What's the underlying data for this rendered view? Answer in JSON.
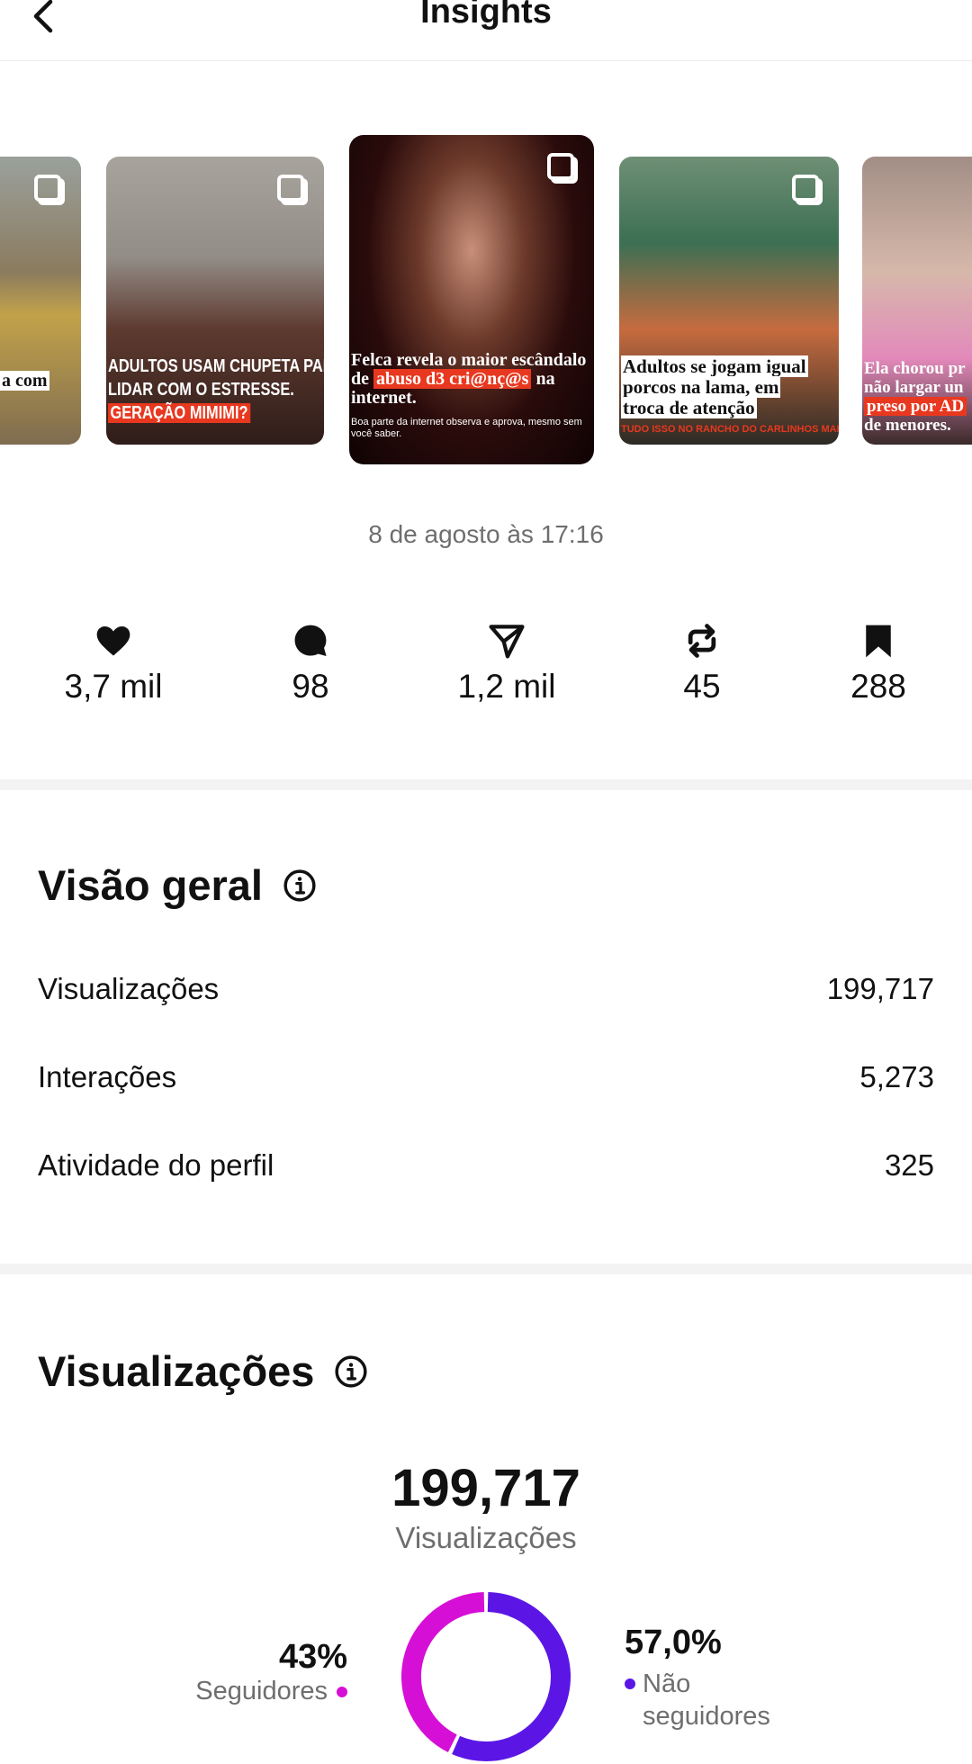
{
  "header": {
    "title": "Insights"
  },
  "carousel": {
    "items": [
      {
        "caption_lines": [
          "a com"
        ]
      },
      {
        "caption_lines": [
          "ADULTOS USAM CHUPETA PARA",
          "LIDAR COM O ESTRESSE."
        ],
        "highlight": "GERAÇÃO MIMIMI?"
      },
      {
        "caption_pre": "Felca revela o maior escândalo de ",
        "highlight": "abuso d3 cri@nç@s",
        "caption_post": " na internet.",
        "subtext": "Boa parte da internet observa e aprova, mesmo sem você saber."
      },
      {
        "caption_lines": [
          "Adultos se jogam igual",
          "porcos na lama, em",
          "troca de atenção"
        ],
        "footer": "TUDO ISSO NO RANCHO DO CARLINHOS MAIA"
      },
      {
        "caption_lines": [
          "Ela chorou pr",
          "não largar un"
        ],
        "highlight": "preso por AD",
        "caption_post": "de menores."
      }
    ]
  },
  "post": {
    "date": "8 de agosto às 17:16"
  },
  "stats": [
    {
      "icon": "heart-icon",
      "value": "3,7 mil"
    },
    {
      "icon": "comment-icon",
      "value": "98"
    },
    {
      "icon": "share-icon",
      "value": "1,2 mil"
    },
    {
      "icon": "repost-icon",
      "value": "45"
    },
    {
      "icon": "bookmark-icon",
      "value": "288"
    }
  ],
  "overview": {
    "title": "Visão geral",
    "rows": [
      {
        "label": "Visualizações",
        "value": "199,717"
      },
      {
        "label": "Interações",
        "value": "5,273"
      },
      {
        "label": "Atividade do perfil",
        "value": "325"
      }
    ]
  },
  "views": {
    "title": "Visualizações",
    "total": "199,717",
    "total_label": "Visualizações",
    "followers": {
      "pct_label": "43%",
      "label": "Seguidores",
      "fraction": 0.43,
      "color": "#d60fd6"
    },
    "non_followers": {
      "pct_label": "57,0%",
      "label": "Não seguidores",
      "fraction": 0.57,
      "color": "#5b16e6"
    }
  }
}
